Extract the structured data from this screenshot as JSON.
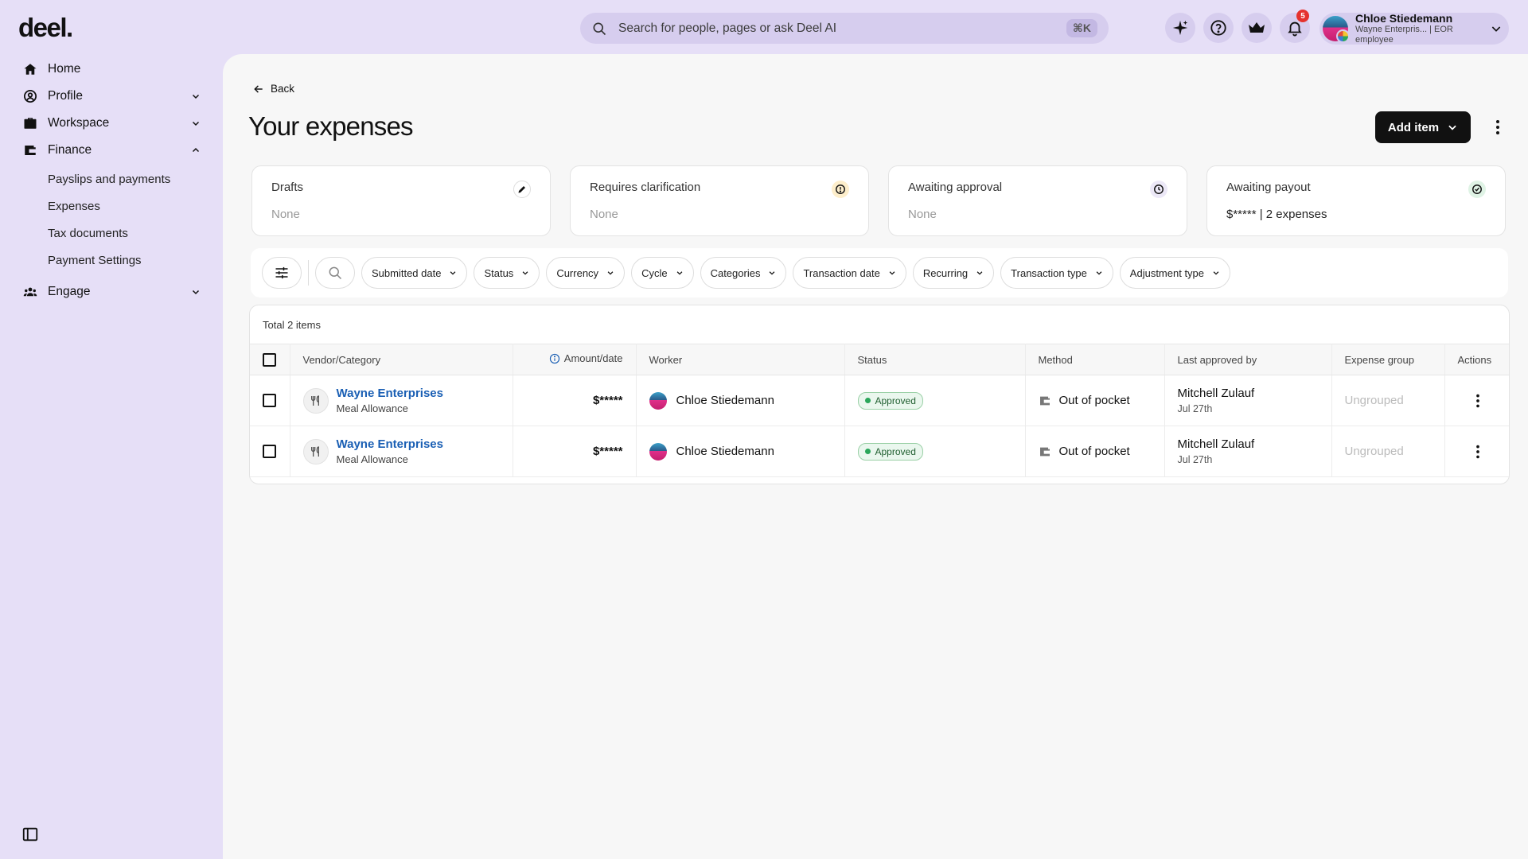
{
  "brand": {
    "logo": "deel."
  },
  "search": {
    "placeholder": "Search for people, pages or ask Deel AI",
    "shortcut": "⌘K"
  },
  "topbar": {
    "notifications_count": "5"
  },
  "user": {
    "name": "Chloe Stiedemann",
    "subtitle": "Wayne Enterpris... | EOR employee"
  },
  "sidebar": {
    "items": [
      {
        "label": "Home"
      },
      {
        "label": "Profile"
      },
      {
        "label": "Workspace"
      },
      {
        "label": "Finance"
      },
      {
        "label": "Engage"
      }
    ],
    "finance_sub": [
      {
        "label": "Payslips and payments"
      },
      {
        "label": "Expenses"
      },
      {
        "label": "Tax documents"
      },
      {
        "label": "Payment Settings"
      }
    ]
  },
  "page": {
    "back_label": "Back",
    "title": "Your expenses",
    "add_label": "Add item"
  },
  "cards": [
    {
      "title": "Drafts",
      "value": "None"
    },
    {
      "title": "Requires clarification",
      "value": "None"
    },
    {
      "title": "Awaiting approval",
      "value": "None"
    },
    {
      "title": "Awaiting payout",
      "value": "$***** | 2 expenses"
    }
  ],
  "filters": [
    "Submitted date",
    "Status",
    "Currency",
    "Cycle",
    "Categories",
    "Transaction date",
    "Recurring",
    "Transaction type",
    "Adjustment type"
  ],
  "table": {
    "total": "Total 2 items",
    "headers": {
      "vendor": "Vendor/Category",
      "amount": "Amount/date",
      "worker": "Worker",
      "status": "Status",
      "method": "Method",
      "approved_by": "Last approved by",
      "group": "Expense group",
      "actions": "Actions"
    },
    "rows": [
      {
        "vendor": "Wayne Enterprises",
        "category": "Meal Allowance",
        "amount": "$*****",
        "worker": "Chloe Stiedemann",
        "status": "Approved",
        "method": "Out of pocket",
        "approver": "Mitchell Zulauf",
        "approved_date": "Jul 27th",
        "group": "Ungrouped"
      },
      {
        "vendor": "Wayne Enterprises",
        "category": "Meal Allowance",
        "amount": "$*****",
        "worker": "Chloe Stiedemann",
        "status": "Approved",
        "method": "Out of pocket",
        "approver": "Mitchell Zulauf",
        "approved_date": "Jul 27th",
        "group": "Ungrouped"
      }
    ]
  }
}
